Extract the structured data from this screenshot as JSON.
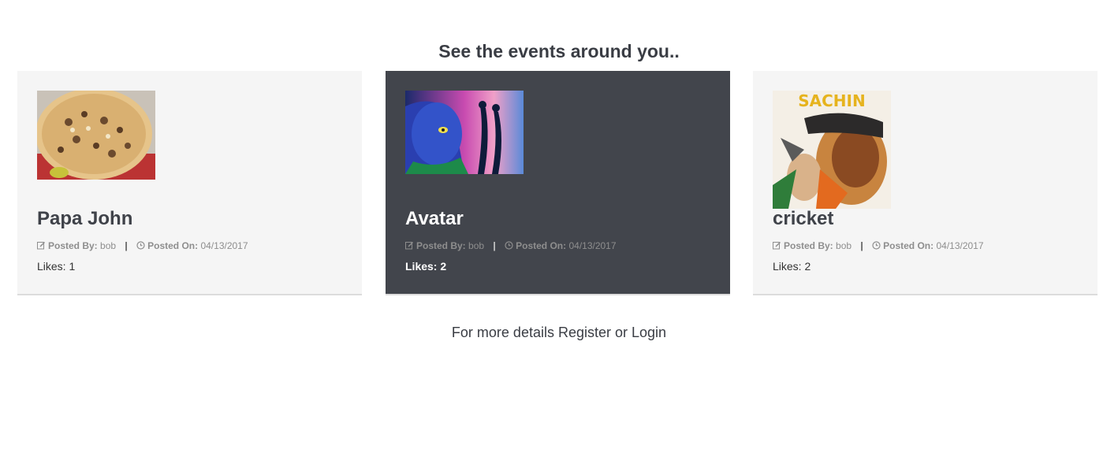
{
  "heading": "See the events around you..",
  "events": [
    {
      "title": "Papa John",
      "image": "pizza-image",
      "posted_by_label": "Posted By:",
      "posted_by": "bob",
      "posted_on_label": "Posted On:",
      "posted_on": "04/13/2017",
      "likes": "Likes: 1"
    },
    {
      "title": "Avatar",
      "image": "avatar-movie-image",
      "posted_by_label": "Posted By:",
      "posted_by": "bob",
      "posted_on_label": "Posted On:",
      "posted_on": "04/13/2017",
      "likes": "Likes: 2"
    },
    {
      "title": "cricket",
      "image": "sachin-poster-image",
      "poster_text": "SACHIN",
      "posted_by_label": "Posted By:",
      "posted_by": "bob",
      "posted_on_label": "Posted On:",
      "posted_on": "04/13/2017",
      "likes": "Likes: 2"
    }
  ],
  "footer": {
    "text_prefix": "For more details ",
    "register": "Register",
    "or": " or ",
    "login": "Login"
  },
  "colors": {
    "card_bg": "#f5f5f5",
    "active_card_bg": "#42454c",
    "heading": "#3a3d44"
  }
}
